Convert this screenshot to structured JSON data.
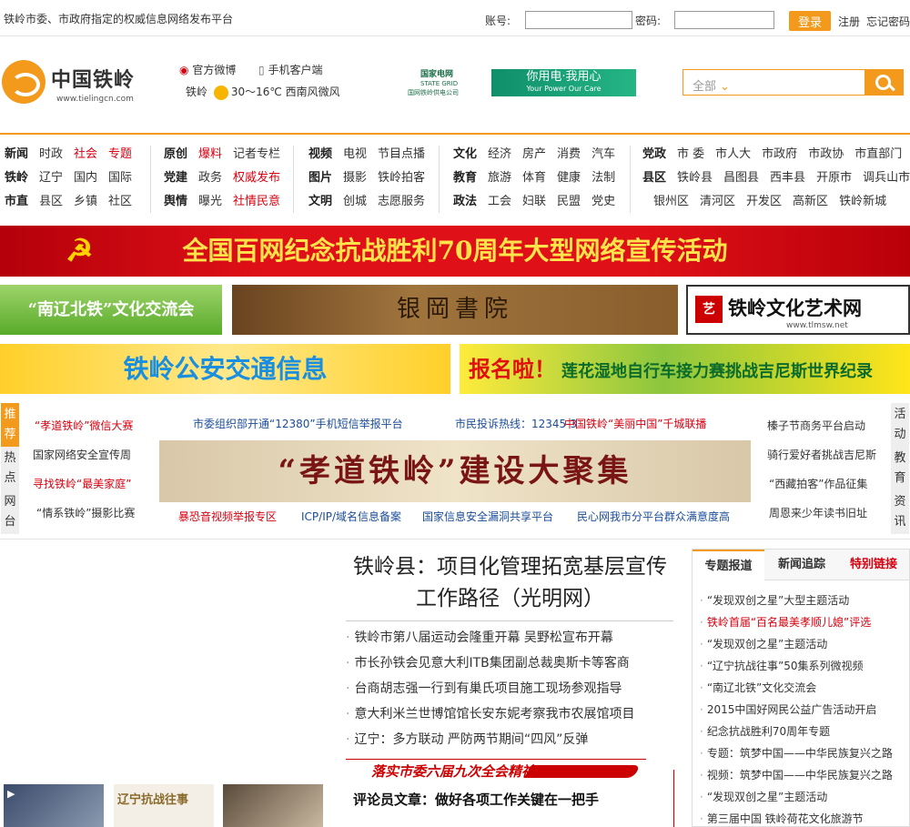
{
  "topbar": {
    "tagline": "铁岭市委、市政府指定的权威信息网络发布平台",
    "account_label": "账号:",
    "password_label": "密码:",
    "login_button": "登录",
    "register_link": "注册",
    "forgot_link": "忘记密码"
  },
  "header": {
    "logo_name": "中国铁岭",
    "logo_url": "www.tielingcn.com",
    "weibo": "官方微博",
    "mobile": "手机客户端",
    "weather_city": "铁岭",
    "weather": "30～16℃ 西南风微风",
    "sgcc_name": "国家电网",
    "sgcc_en": "STATE GRID",
    "sgcc_sub": "国网铁岭供电公司",
    "sgcc_slogan": "你用电·我用心",
    "sgcc_slogan_en": "Your Power Our Care",
    "search_select": "全部"
  },
  "nav": {
    "groups": [
      [
        [
          "新闻",
          "时政",
          "社会",
          "专题"
        ],
        [
          "铁岭",
          "辽宁",
          "国内",
          "国际"
        ],
        [
          "市直",
          "县区",
          "乡镇",
          "社区"
        ]
      ],
      [
        [
          "原创",
          "爆料",
          "记者专栏"
        ],
        [
          "党建",
          "政务",
          "权威发布"
        ],
        [
          "舆情",
          "曝光",
          "社情民意"
        ]
      ],
      [
        [
          "视频",
          "电视",
          "节目点播"
        ],
        [
          "图片",
          "摄影",
          "铁岭拍客"
        ],
        [
          "文明",
          "创城",
          "志愿服务"
        ]
      ],
      [
        [
          "文化",
          "经济",
          "房产",
          "消费",
          "汽车"
        ],
        [
          "教育",
          "旅游",
          "体育",
          "健康",
          "法制"
        ],
        [
          "政法",
          "工会",
          "妇联",
          "民盟",
          "党史"
        ]
      ],
      [
        [
          "党政",
          "市 委",
          "市人大",
          "市政府",
          "市政协",
          "市直部门"
        ],
        [
          "县区",
          "铁岭县",
          "昌图县",
          "西丰县",
          "开原市",
          "调兵山市"
        ],
        [
          "",
          "银州区",
          "清河区",
          "开发区",
          "高新区",
          "铁岭新城"
        ]
      ]
    ]
  },
  "banners": {
    "war": "全国百网纪念抗战胜利70周年大型网络宣传活动",
    "nanliao": "“南辽北铁”文化交流会",
    "yingang": "银岡書院",
    "tlmsw": "铁岭文化艺术网",
    "tlmsw_url": "www.tlmsw.net",
    "police": "铁岭公安交通信息",
    "bike_tag": "报名啦！",
    "bike": "莲花湿地自行车接力赛挑战吉尼斯世界纪录",
    "xiaodao": "“孝道铁岭”建设大聚集"
  },
  "rec": {
    "left_tabs": [
      "推荐",
      "热点",
      "网台"
    ],
    "right_tabs": [
      "活动",
      "教育",
      "资讯"
    ],
    "left_links": [
      "“孝道铁岭”微信大赛",
      "国家网络安全宣传周",
      "寻找铁岭“最美家庭”",
      "“情系铁岭”摄影比赛"
    ],
    "top_links": [
      "市委组织部开通“12380”手机短信举报平台",
      "市民投诉热线：12345-3",
      "中国铁岭“美丽中国”千城联播"
    ],
    "bottom_links": [
      "暴恐音视频举报专区",
      "ICP/IP/域名信息备案",
      "国家信息安全漏洞共享平台",
      "民心网我市分平台群众满意度高"
    ],
    "right_links": [
      "榛子节商务平台启动",
      "骑行爱好者挑战吉尼斯",
      "“西藏拍客”作品征集",
      "周恩来少年读书旧址"
    ]
  },
  "main": {
    "headline": "铁岭县：项目化管理拓宽基层宣传工作路径（光明网）",
    "news": [
      "铁岭市第八届运动会隆重开幕 吴野松宣布开幕",
      "市长孙铁会见意大利ITB集团副总裁奥斯卡等客商",
      "台商胡志强一行到有巢氏项目施工现场参观指导",
      "意大利米兰世博馆馆长安东妮考察我市农展馆项目",
      "辽宁：多方联动 严防两节期间“四风”反弹"
    ],
    "spirit": "落实市委六届九次全会精神",
    "comment": "评论员文章：做好各项工作关键在一把手",
    "thumb2": "辽宁抗战往事"
  },
  "special": {
    "tabs": [
      "专题报道",
      "新闻追踪",
      "特别链接"
    ],
    "items": [
      "“发现双创之星”大型主题活动",
      "铁岭首届“百名最美孝顺儿媳”评选",
      "“发现双创之星”主题活动",
      "“辽宁抗战往事”50集系列微视频",
      "“南辽北铁”文化交流会",
      "2015中国好网民公益广告活动开启",
      "纪念抗战胜利70周年专题",
      "专题：筑梦中国——中华民族复兴之路",
      "视频：筑梦中国——中华民族复兴之路",
      "“发现双创之星”主题活动",
      "第三届中国 铁岭荷花文化旅游节"
    ]
  }
}
